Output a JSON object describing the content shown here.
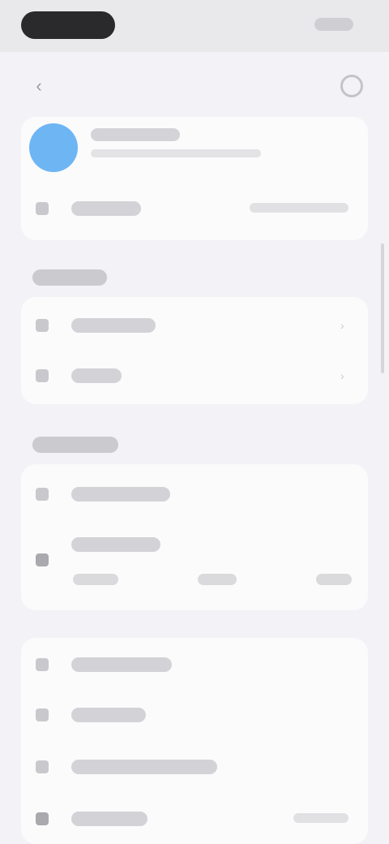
{
  "status_bar": {},
  "nav": {},
  "profile": {},
  "sections": [
    {
      "rows": [
        {},
        {}
      ]
    },
    {
      "rows": [
        {},
        {}
      ]
    },
    {
      "rows": [
        {},
        {},
        {},
        {}
      ]
    }
  ],
  "colors": {
    "avatar": "#6eb5f4",
    "background": "#f2f2f7",
    "card": "#fbfbfc"
  }
}
